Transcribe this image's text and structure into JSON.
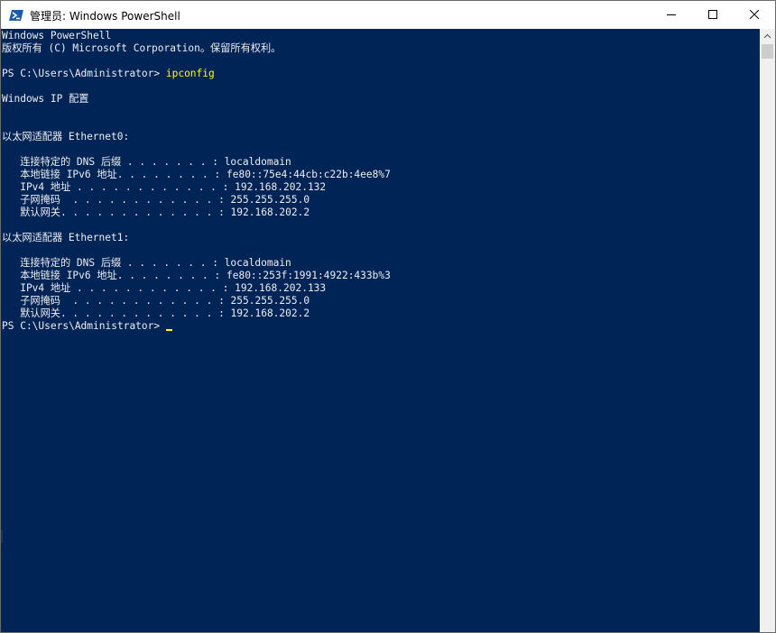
{
  "window": {
    "title": "管理员: Windows PowerShell",
    "icon": "powershell-icon",
    "controls": {
      "minimize": "minimize-icon",
      "maximize": "maximize-icon",
      "close": "close-icon"
    }
  },
  "colors": {
    "console_bg": "#012456",
    "console_fg": "#eeedf0",
    "command": "#ffff00"
  },
  "console": {
    "header_line1": "Windows PowerShell",
    "header_line2": "版权所有 (C) Microsoft Corporation。保留所有权利。",
    "prompt": "PS C:\\Users\\Administrator> ",
    "command": "ipconfig",
    "ip_config_title": "Windows IP 配置",
    "adapters": [
      {
        "header": "以太网适配器 Ethernet0:",
        "fields": [
          "   连接特定的 DNS 后缀 . . . . . . . : localdomain",
          "   本地链接 IPv6 地址. . . . . . . . : fe80::75e4:44cb:c22b:4ee8%7",
          "   IPv4 地址 . . . . . . . . . . . . : 192.168.202.132",
          "   子网掩码  . . . . . . . . . . . . : 255.255.255.0",
          "   默认网关. . . . . . . . . . . . . : 192.168.202.2"
        ]
      },
      {
        "header": "以太网适配器 Ethernet1:",
        "fields": [
          "   连接特定的 DNS 后缀 . . . . . . . : localdomain",
          "   本地链接 IPv6 地址. . . . . . . . : fe80::253f:1991:4922:433b%3",
          "   IPv4 地址 . . . . . . . . . . . . : 192.168.202.133",
          "   子网掩码  . . . . . . . . . . . . : 255.255.255.0",
          "   默认网关. . . . . . . . . . . . . : 192.168.202.2"
        ]
      }
    ],
    "final_prompt": "PS C:\\Users\\Administrator> "
  },
  "scrollbar": {
    "up_arrow": "chevron-up-icon"
  }
}
